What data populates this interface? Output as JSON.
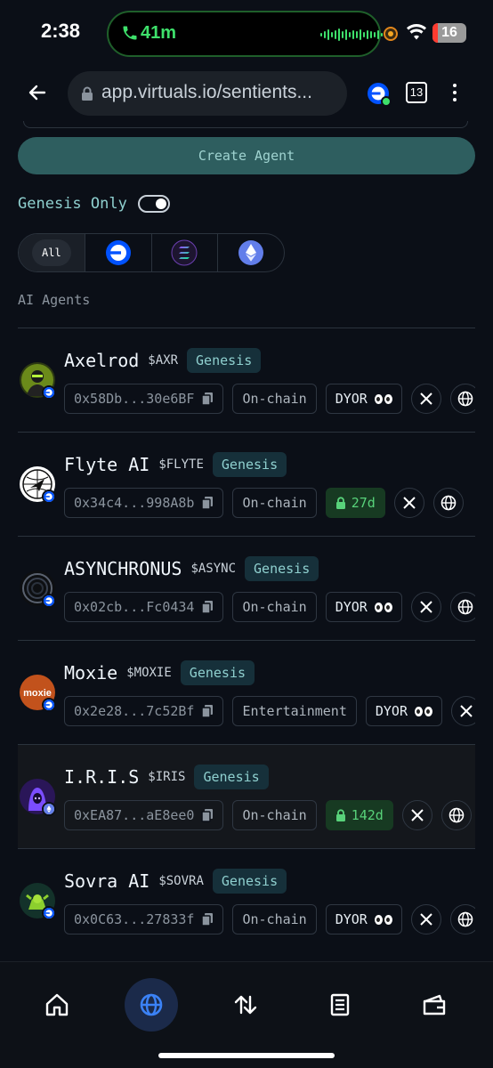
{
  "status_bar": {
    "time": "2:38",
    "call_timer": "41m",
    "battery_level": "16",
    "battery_fraction": 0.16
  },
  "browser": {
    "url": "app.virtuals.io/sentients...",
    "tab_count": "13"
  },
  "actions": {
    "create_agent_label": "Create Agent"
  },
  "filters": {
    "genesis_only_label": "Genesis Only",
    "genesis_only_on": true,
    "chains": [
      {
        "label": "All",
        "icon": "all",
        "active": true
      },
      {
        "icon": "base-icon"
      },
      {
        "icon": "solana-icon"
      },
      {
        "icon": "ethereum-icon"
      }
    ]
  },
  "section_title": "AI Agents",
  "colors": {
    "accent_teal": "#8fd0cf",
    "create_button": "#2e5e5f",
    "lock_green": "#58d27a",
    "base_blue": "#0052ff",
    "eth_purple": "#627eea"
  },
  "agents": [
    {
      "name": "Axelrod",
      "ticker": "$AXR",
      "tag": "Genesis",
      "address": "0x58Db...30e6BF",
      "category": "On-chain",
      "status": "DYOR",
      "chain": "base",
      "avatar": "axelrod"
    },
    {
      "name": "Flyte AI",
      "ticker": "$FLYTE",
      "tag": "Genesis",
      "address": "0x34c4...998A8b",
      "category": "On-chain",
      "status": "27d",
      "chain": "base",
      "avatar": "flyte"
    },
    {
      "name": "ASYNCHRONUS",
      "ticker": "$ASYNC",
      "tag": "Genesis",
      "address": "0x02cb...Fc0434",
      "category": "On-chain",
      "status": "DYOR",
      "chain": "base",
      "avatar": "async"
    },
    {
      "name": "Moxie",
      "ticker": "$MOXIE",
      "tag": "Genesis",
      "address": "0x2e28...7c52Bf",
      "category": "Entertainment",
      "status": "DYOR",
      "chain": "base",
      "avatar": "moxie",
      "avatar_text": "moxie"
    },
    {
      "name": "I.R.I.S",
      "ticker": "$IRIS",
      "tag": "Genesis",
      "address": "0xEA87...aE8ee0",
      "category": "On-chain",
      "status": "142d",
      "chain": "ethereum",
      "avatar": "iris"
    },
    {
      "name": "Sovra AI",
      "ticker": "$SOVRA",
      "tag": "Genesis",
      "address": "0x0C63...27833f",
      "category": "On-chain",
      "status": "DYOR",
      "chain": "base",
      "avatar": "sovra"
    }
  ],
  "bottom_nav": [
    {
      "icon": "home-icon"
    },
    {
      "icon": "globe-icon",
      "active": true
    },
    {
      "icon": "swap-icon"
    },
    {
      "icon": "document-icon"
    },
    {
      "icon": "wallet-icon"
    }
  ]
}
